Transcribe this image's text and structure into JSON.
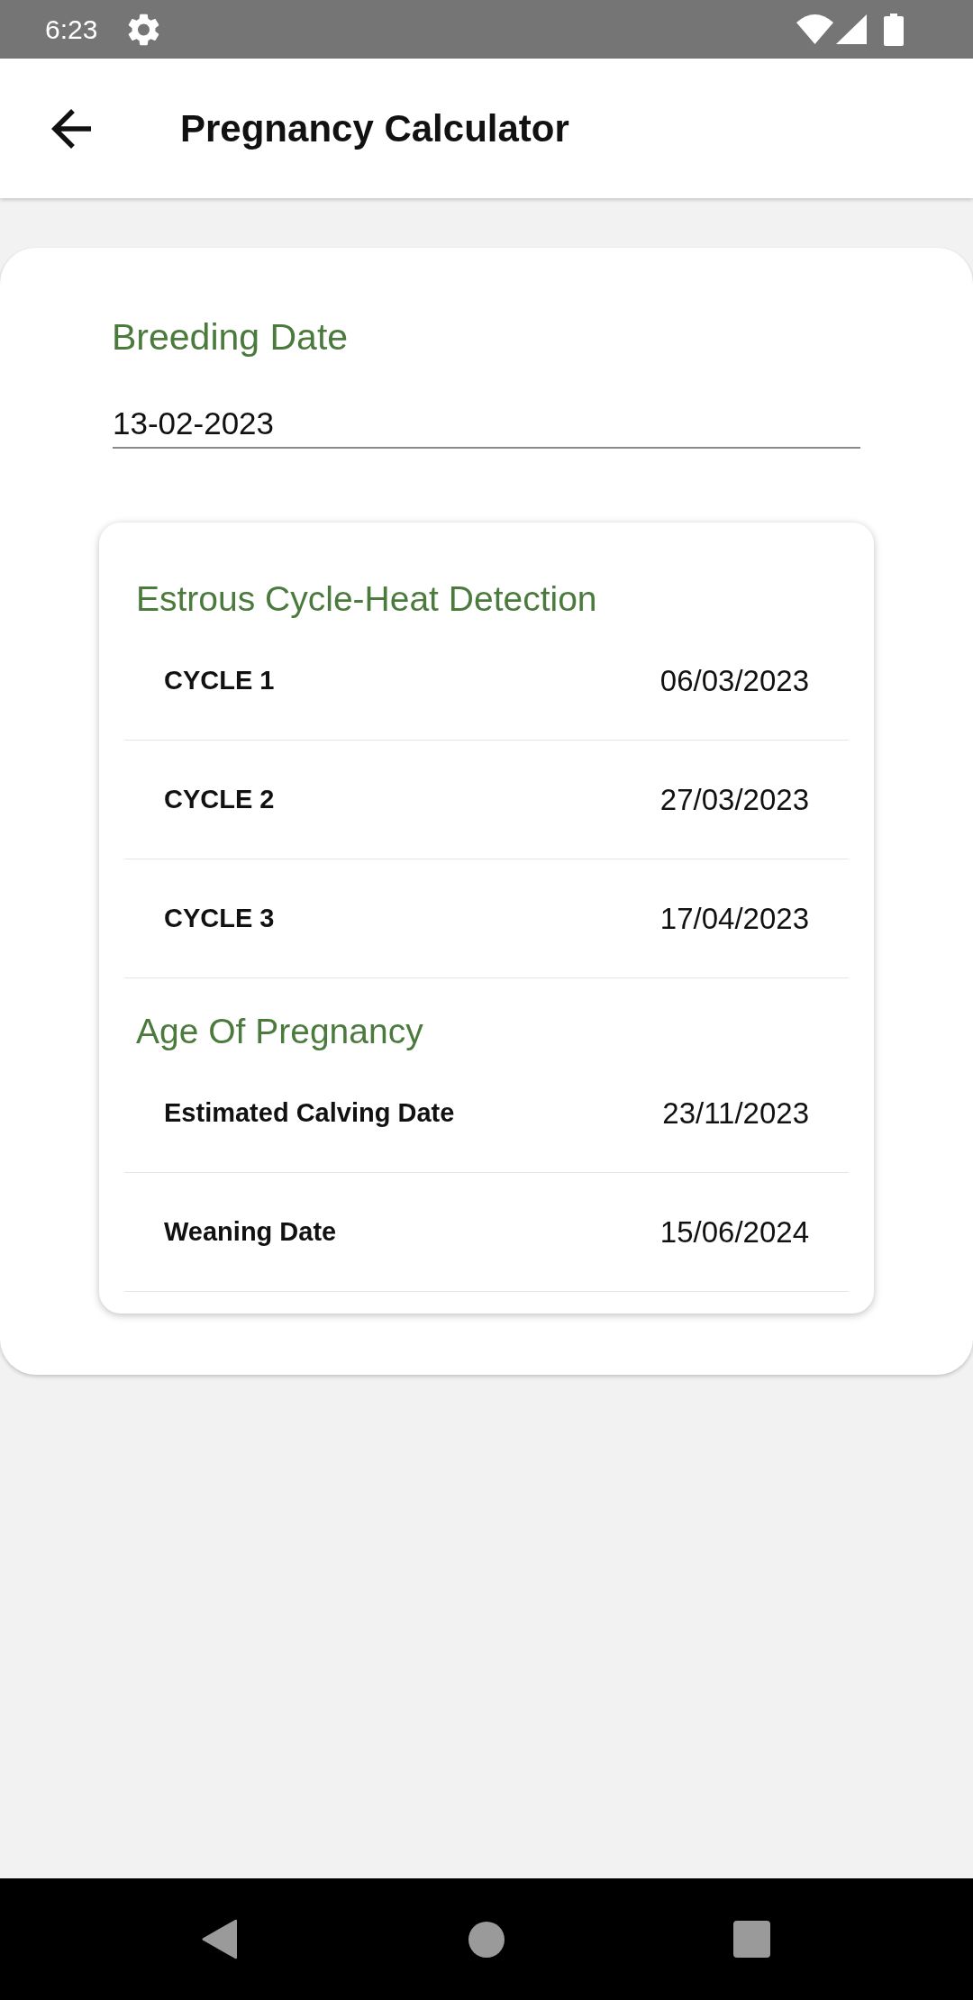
{
  "status_bar": {
    "time": "6:23"
  },
  "app_bar": {
    "title": "Pregnancy Calculator"
  },
  "breeding_date": {
    "label": "Breeding Date",
    "value": "13-02-2023"
  },
  "sections": [
    {
      "title": "Estrous Cycle-Heat Detection",
      "rows": [
        {
          "label": "CYCLE 1",
          "value": "06/03/2023"
        },
        {
          "label": "CYCLE 2",
          "value": "27/03/2023"
        },
        {
          "label": "CYCLE 3",
          "value": "17/04/2023"
        }
      ]
    },
    {
      "title": "Age Of Pregnancy",
      "rows": [
        {
          "label": "Estimated Calving Date",
          "value": "23/11/2023"
        },
        {
          "label": "Weaning Date",
          "value": "15/06/2024"
        }
      ]
    }
  ]
}
